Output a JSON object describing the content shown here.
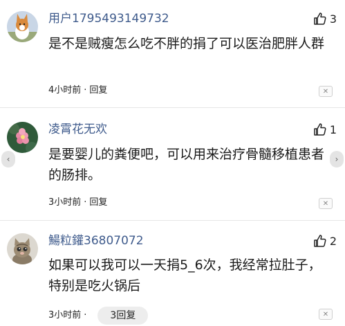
{
  "comments": [
    {
      "username": "用户1795493149732",
      "avatar_icon": "corgi-dog-avatar-icon",
      "like_count": "3",
      "text": "是不是贼瘦怎么吃不胖的捐了可以医治肥胖人群",
      "time": "4小时前",
      "separator": "·",
      "reply_label": "回复"
    },
    {
      "username": "凌霄花无欢",
      "avatar_icon": "flower-avatar-icon",
      "like_count": "1",
      "text": "是要婴儿的粪便吧，可以用来治疗骨髓移植患者的肠排。",
      "time": "3小时前",
      "separator": "·",
      "reply_label": "回复"
    },
    {
      "username": "鰑粒鑵36807072",
      "avatar_icon": "kitten-avatar-icon",
      "like_count": "2",
      "text": "如果可以我可以一天捐5_6次，我经常拉肚子，特别是吃火锅后",
      "time": "3小时前",
      "separator": "·",
      "replies_label": "3回复"
    }
  ],
  "icons": {
    "like": "thumbs-up-icon",
    "close": "close-icon",
    "prev": "chevron-left-icon",
    "next": "chevron-right-icon"
  },
  "colors": {
    "username": "#3f5b8c",
    "divider": "#e6e6e6",
    "pill": "#ededed"
  },
  "glyphs": {
    "close": "✕",
    "prev": "‹",
    "next": "›"
  }
}
